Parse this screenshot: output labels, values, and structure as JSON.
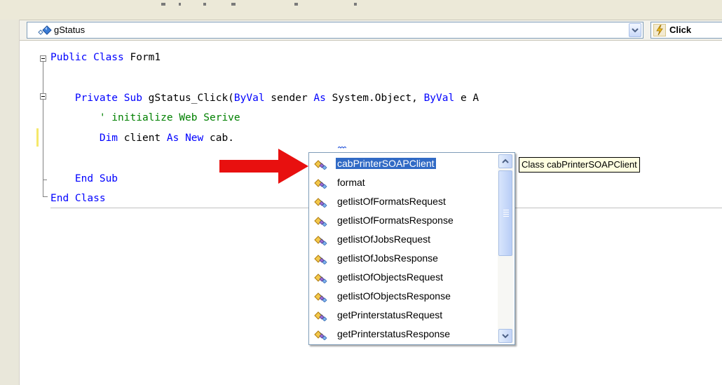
{
  "navbar": {
    "object_combo": "gStatus",
    "event_combo": "Click"
  },
  "code": {
    "line1": {
      "kw": "Public Class",
      "rest": " Form1"
    },
    "line2": {
      "indent": "    ",
      "kw1": "Private Sub",
      "text1": " gStatus_Click(",
      "kw2": "ByVal",
      "text2": " sender ",
      "kw3": "As",
      "text3": " System.Object, ",
      "kw4": "ByVal",
      "text4": " e A"
    },
    "line3": {
      "indent": "        ",
      "comment": "' initialize Web Serive"
    },
    "line4": {
      "indent": "        ",
      "kw1": "Dim",
      "text1": " client ",
      "kw2": "As New",
      "text2": " cab."
    },
    "line5": {
      "indent": "    ",
      "kw": "End Sub"
    },
    "line6": {
      "kw": "End Class"
    }
  },
  "intellisense": {
    "items": [
      {
        "label": "cabPrinterSOAPClient",
        "icon": "class-icon",
        "selected": true
      },
      {
        "label": "format",
        "icon": "class-icon"
      },
      {
        "label": "getlistOfFormatsRequest",
        "icon": "class-icon"
      },
      {
        "label": "getlistOfFormatsResponse",
        "icon": "class-icon"
      },
      {
        "label": "getlistOfJobsRequest",
        "icon": "class-icon"
      },
      {
        "label": "getlistOfJobsResponse",
        "icon": "class-icon"
      },
      {
        "label": "getlistOfObjectsRequest",
        "icon": "class-icon"
      },
      {
        "label": "getlistOfObjectsResponse",
        "icon": "class-icon"
      },
      {
        "label": "getPrinterstatusRequest",
        "icon": "class-icon"
      },
      {
        "label": "getPrinterstatusResponse",
        "icon": "class-icon"
      }
    ],
    "tooltip": "Class cabPrinterSOAPClient"
  },
  "colors": {
    "keyword": "#0000ff",
    "comment": "#008000",
    "selection": "#316ac5",
    "tooltip_bg": "#ffffe1",
    "arrow": "#e8100f"
  }
}
